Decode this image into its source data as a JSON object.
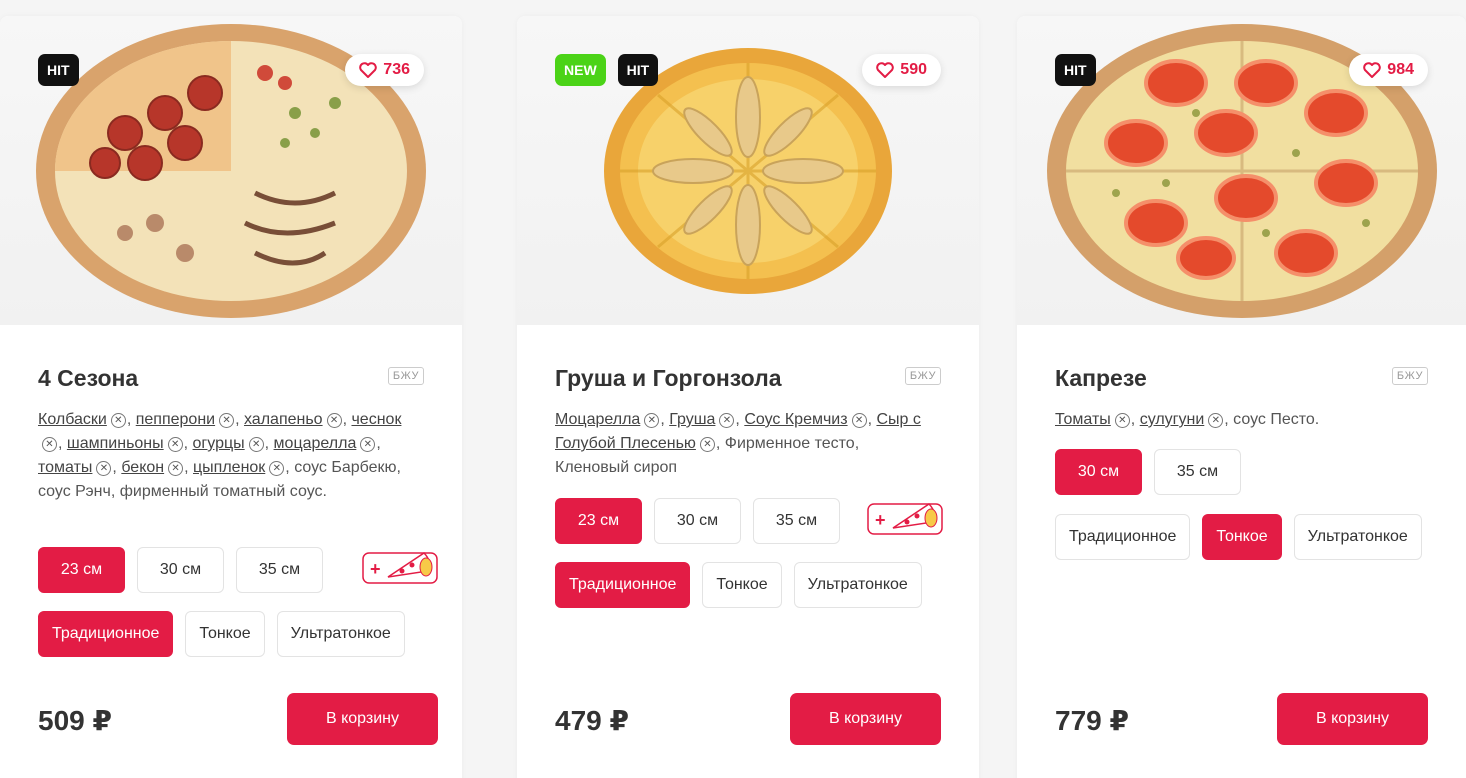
{
  "products": [
    {
      "name": "Груша и Горгонзола",
      "badges": [
        "NEW",
        "HIT"
      ],
      "likes": "590",
      "bju_label": "БЖУ",
      "ingredients_removable": [
        "Моцарелла",
        "Груша",
        "Соус Кремчиз",
        "Сыр с Голубой Плесенью"
      ],
      "ingredients_fixed": "Фирменное тесто, Кленовый сироп",
      "sizes": [
        "23 см",
        "30 см",
        "35 см"
      ],
      "selected_size": "23 см",
      "doughs": [
        "Традиционное",
        "Тонкое",
        "Ультратонкое"
      ],
      "selected_dough": "Традиционное",
      "price": "479 ₽",
      "cart_label": "В корзину",
      "addon_icon": "add-cheese-crust-icon"
    },
    {
      "name": "Капрезе",
      "badges": [
        "HIT"
      ],
      "likes": "984",
      "bju_label": "БЖУ",
      "ingredients_removable": [
        "Томаты",
        "сулугуни"
      ],
      "ingredients_fixed": "соус Песто.",
      "sizes": [
        "30 см",
        "35 см"
      ],
      "selected_size": "30 см",
      "doughs": [
        "Традиционное",
        "Тонкое",
        "Ультратонкое"
      ],
      "selected_dough": "Тонкое",
      "price": "779 ₽",
      "cart_label": "В корзину"
    },
    {
      "name": "4 Сезона",
      "badges": [
        "HIT"
      ],
      "likes": "736",
      "bju_label": "БЖУ",
      "ingredients_removable": [
        "Колбаски",
        "пепперони",
        "халапеньо",
        "чеснок",
        "шампиньоны",
        "огурцы",
        "моцарелла",
        "томаты",
        "бекон",
        "цыпленок"
      ],
      "ingredients_fixed": "соус Барбекю, соус Рэнч, фирменный томатный соус.",
      "sizes": [
        "23 см",
        "30 см",
        "35 см"
      ],
      "selected_size": "23 см",
      "doughs": [
        "Традиционное",
        "Тонкое",
        "Ультратонкое"
      ],
      "selected_dough": "Традиционное",
      "price": "509 ₽",
      "cart_label": "В корзину",
      "addon_icon": "add-cheese-crust-icon"
    }
  ],
  "colors": {
    "accent": "#e31c45",
    "new_badge": "#4bd317",
    "hit_badge": "#111111"
  }
}
